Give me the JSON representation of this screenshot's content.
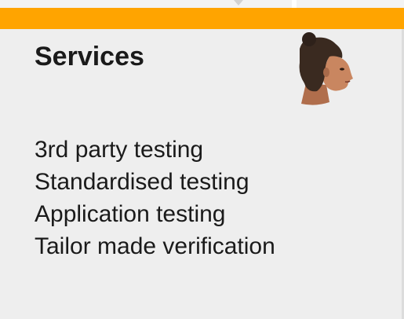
{
  "panel": {
    "title": "Services",
    "items": [
      "3rd party testing",
      "Standardised testing",
      "Application testing",
      "Tailor made verification"
    ]
  },
  "icons": {
    "avatar": "woman-head-avatar-icon"
  },
  "colors": {
    "accent": "#ffa400",
    "panel_bg": "#eeeeee",
    "text": "#1a1a1a"
  }
}
